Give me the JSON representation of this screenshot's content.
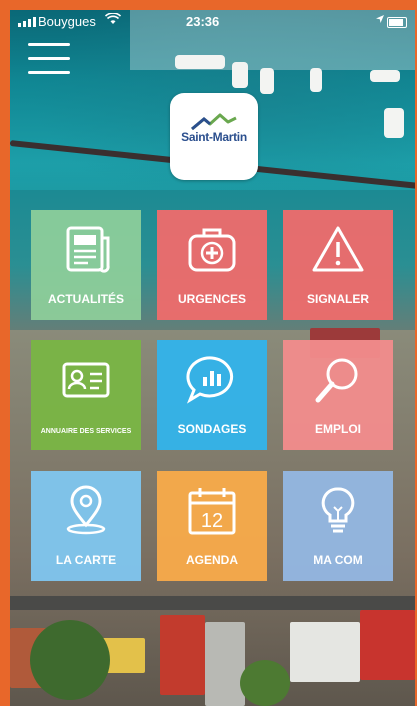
{
  "status_bar": {
    "carrier": "Bouygues",
    "time": "23:36"
  },
  "logo": {
    "name": "Saint-Martin"
  },
  "tiles": [
    {
      "label": "ACTUALITÉS",
      "icon": "newspaper-icon",
      "color": "#8fcf9a"
    },
    {
      "label": "URGENCES",
      "icon": "first-aid-kit-icon",
      "color": "#ef6b6b"
    },
    {
      "label": "SIGNALER",
      "icon": "warning-icon",
      "color": "#ef6b6b"
    },
    {
      "label": "ANNUAIRE DES SERVICES",
      "icon": "id-card-icon",
      "color": "#7ab545"
    },
    {
      "label": "SONDAGES",
      "icon": "poll-chat-icon",
      "color": "#34b3e8"
    },
    {
      "label": "EMPLOI",
      "icon": "magnifier-icon",
      "color": "#f28c8c"
    },
    {
      "label": "LA CARTE",
      "icon": "map-pin-icon",
      "color": "#7fc6ef"
    },
    {
      "label": "AGENDA",
      "icon": "calendar-icon",
      "color": "#f6a94a"
    },
    {
      "label": "MA COM",
      "icon": "lightbulb-icon",
      "color": "#93b7e3"
    }
  ],
  "calendar_day": "12",
  "colors": {
    "frame": "#e8672a",
    "logo_blue": "#2b4f8e",
    "logo_green": "#6aa84f"
  }
}
